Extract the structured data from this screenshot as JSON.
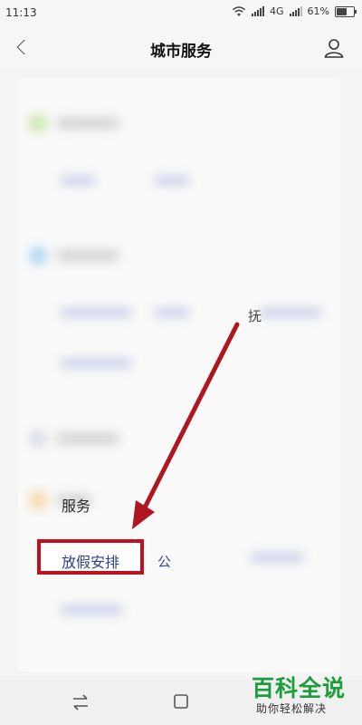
{
  "status_bar": {
    "time": "11:13",
    "network": "4G",
    "battery": "61%",
    "battery_level": 0.61
  },
  "header": {
    "title": "城市服务"
  },
  "section": {
    "label_partial": "服务"
  },
  "highlight": {
    "label": "放假安排"
  },
  "partial_items": {
    "item_a": "公",
    "item_b": "抚"
  },
  "watermark": {
    "title": "百科全说",
    "subtitle": "助你轻松解决"
  },
  "colors": {
    "highlight_border": "#c0121e",
    "arrow": "#b01520",
    "watermark_green": "#1a9d3a"
  }
}
